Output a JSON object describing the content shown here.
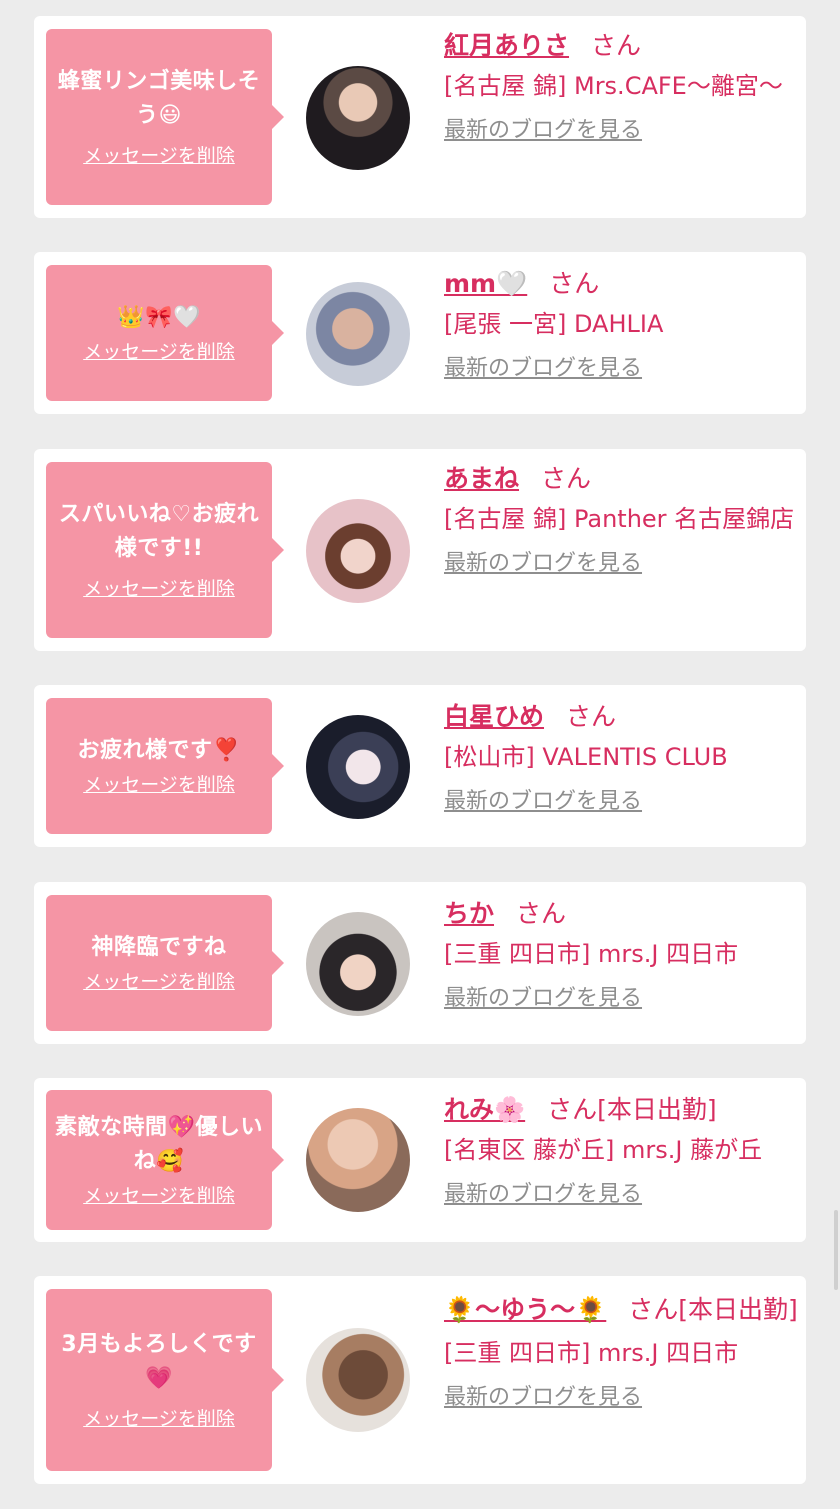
{
  "delete_label": "メッセージを削除",
  "blog_label": "最新のブログを見る",
  "san_label": "さん",
  "colors": {
    "accent": "#d72e60",
    "bubble": "#f595a5",
    "background": "#ececec"
  },
  "items": [
    {
      "message": "蜂蜜リンゴ美味しそう😃",
      "name": "紅月ありさ",
      "san": "さん",
      "shop": "[名古屋 錦] Mrs.CAFE〜離宮〜"
    },
    {
      "message": "👑🎀🤍",
      "name": "mm🤍",
      "san": "さん",
      "shop": "[尾張 一宮] DAHLIA"
    },
    {
      "message": "スパいいね♡お疲れ様です!!",
      "name": "あまね",
      "san": "さん",
      "shop": "[名古屋 錦] Panther 名古屋錦店"
    },
    {
      "message": "お疲れ様です❣️",
      "name": "白星ひめ",
      "san": "さん",
      "shop": "[松山市] VALENTIS CLUB"
    },
    {
      "message": "神降臨ですね",
      "name": "ちか",
      "san": "さん",
      "shop": "[三重 四日市] mrs.J 四日市"
    },
    {
      "message": "素敵な時間💖優しいね🥰",
      "name": "れみ🌸",
      "san": "さん[本日出勤]",
      "shop": "[名東区 藤が丘] mrs.J 藤が丘"
    },
    {
      "message": "3月もよろしくです💗",
      "name": "🌻〜ゆう〜🌻",
      "san": "さん[本日出勤]",
      "shop": "[三重 四日市] mrs.J 四日市"
    }
  ]
}
